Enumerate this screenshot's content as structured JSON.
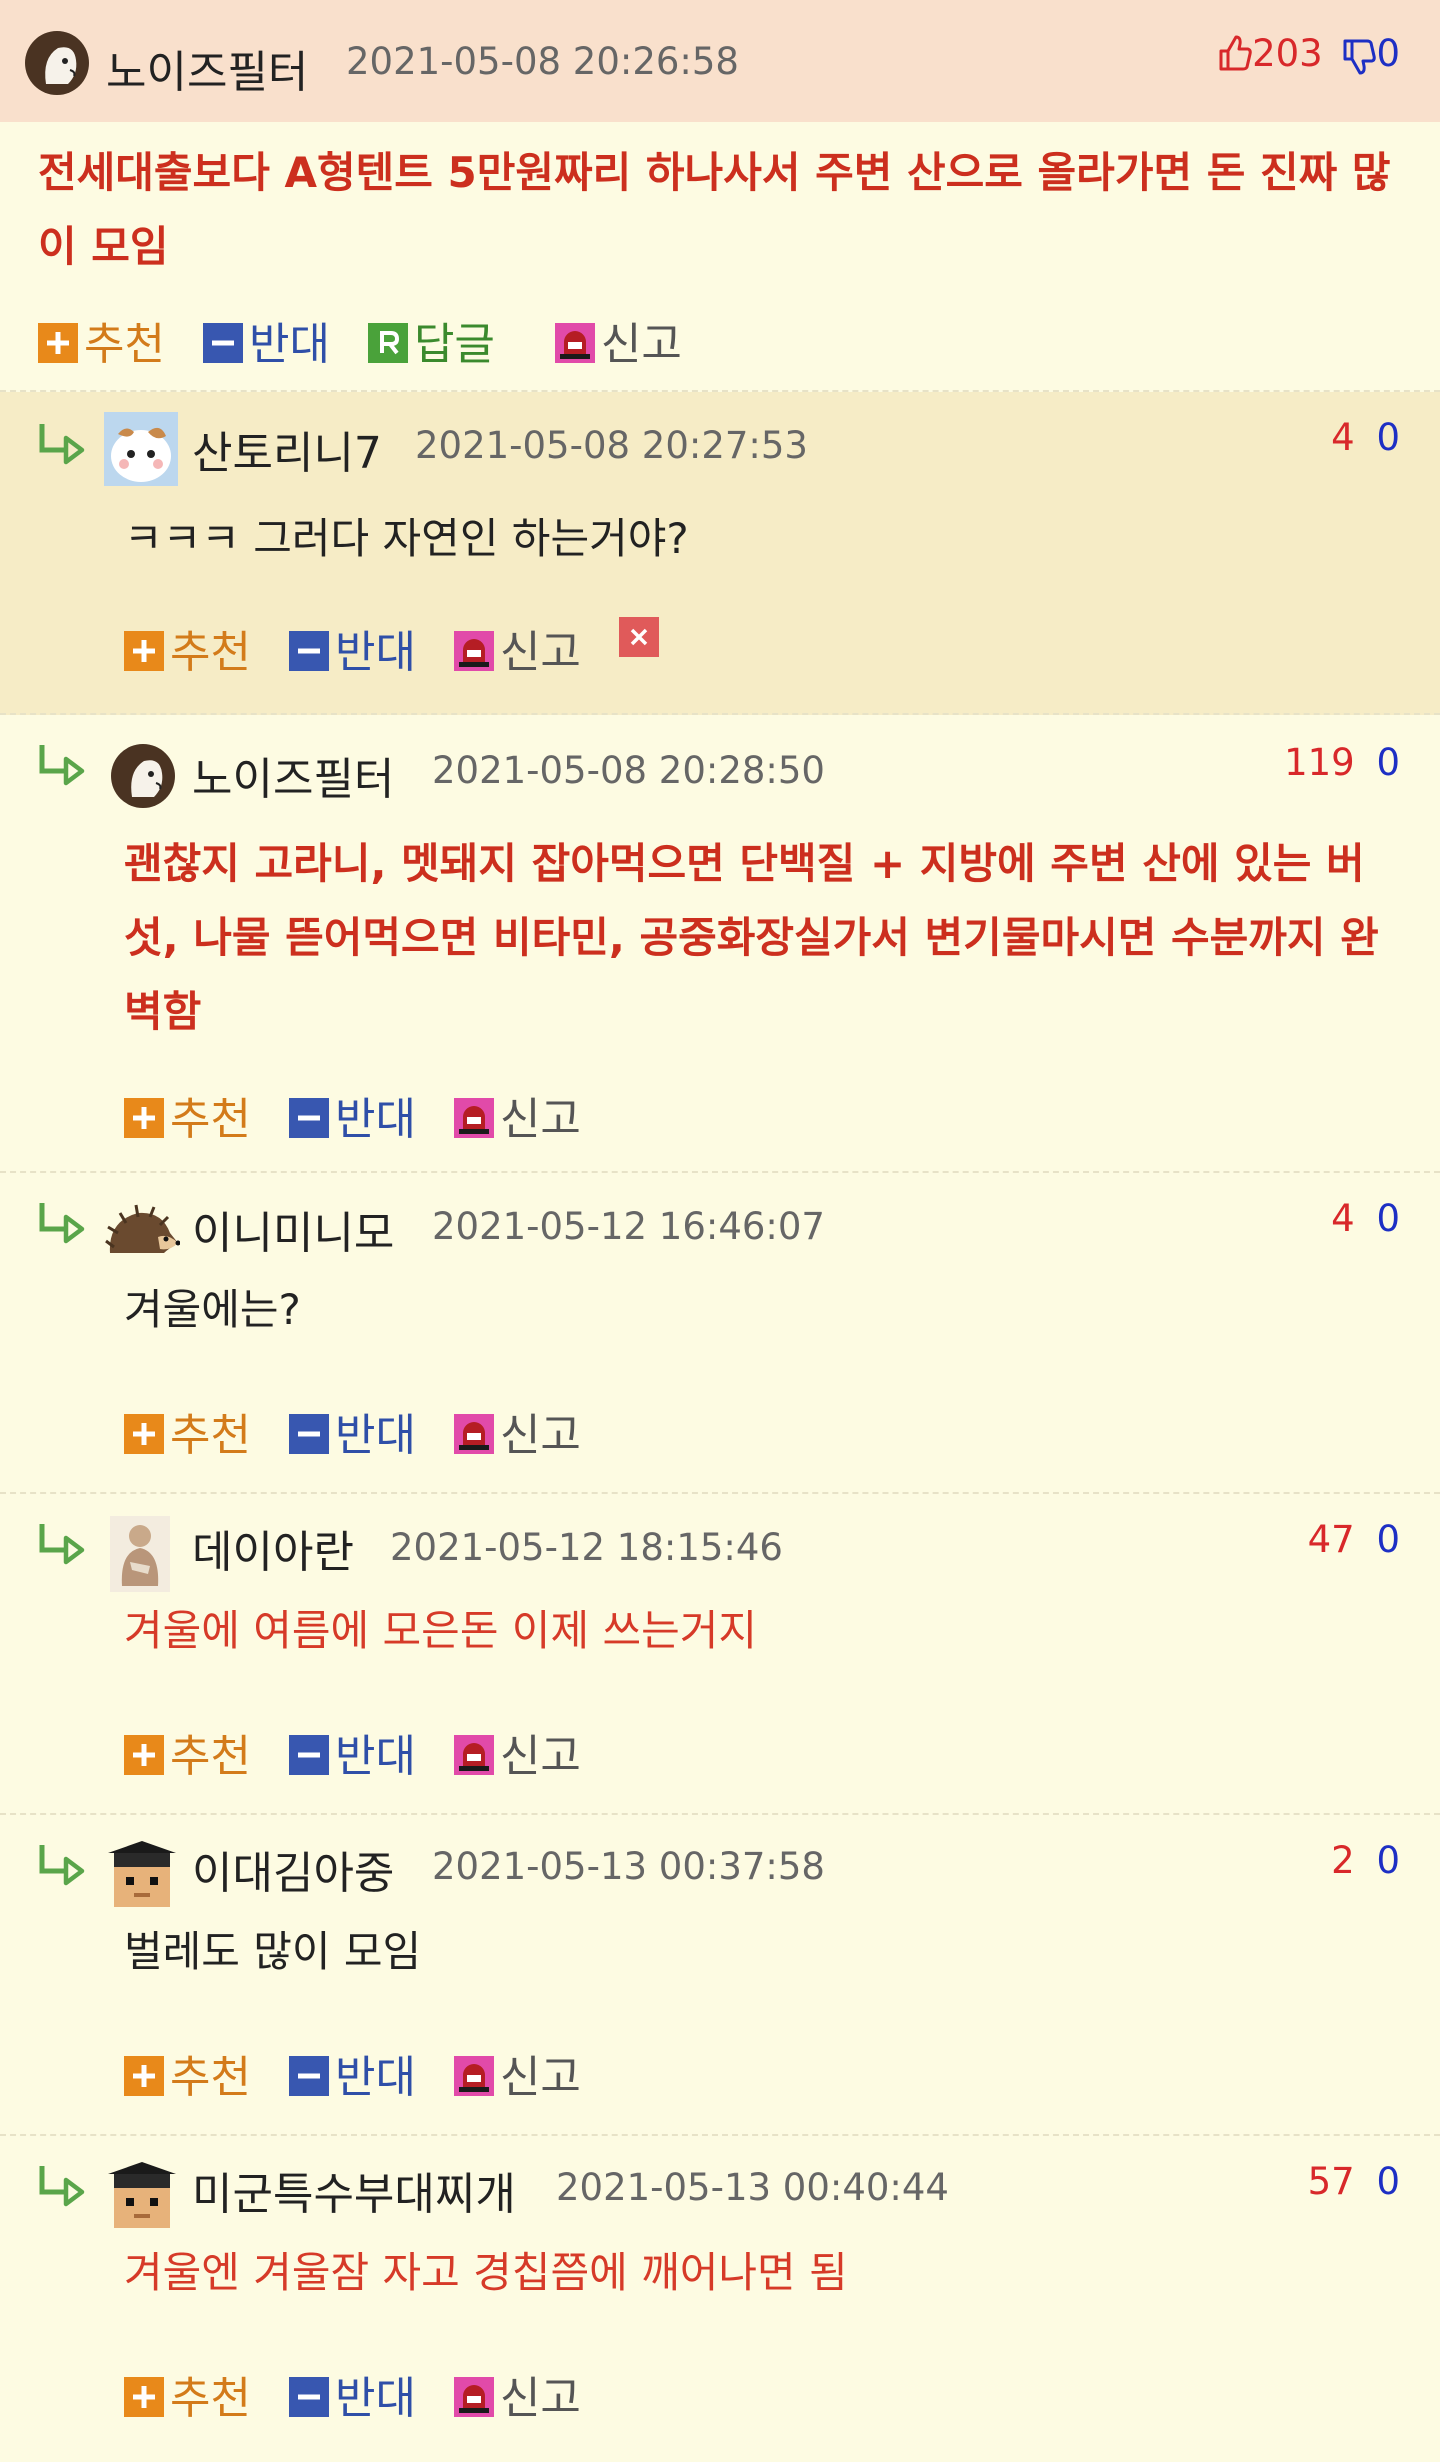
{
  "labels": {
    "recommend": "추천",
    "oppose": "반대",
    "reply": "답글",
    "report": "신고"
  },
  "comments": [
    {
      "nick": "노이즈필터",
      "date": "2021-05-08 20:26:58",
      "up": "203",
      "down": "0",
      "text": "전세대출보다 A형텐트 5만원짜리 하나사서 주변 산으로 올라가면 돈 진짜 많이 모임"
    },
    {
      "nick": "산토리니7",
      "date": "2021-05-08 20:27:53",
      "up": "4",
      "down": "0",
      "text": "ㅋㅋㅋ 그러다 자연인 하는거야?"
    },
    {
      "nick": "노이즈필터",
      "date": "2021-05-08 20:28:50",
      "up": "119",
      "down": "0",
      "text": "괜찮지 고라니, 멧돼지 잡아먹으면 단백질 + 지방에 주변 산에 있는 버섯, 나물 뜯어먹으면 비타민, 공중화장실가서 변기물마시면 수분까지 완벽함"
    },
    {
      "nick": "이니미니모",
      "date": "2021-05-12 16:46:07",
      "up": "4",
      "down": "0",
      "text": "겨울에는?"
    },
    {
      "nick": "데이아란",
      "date": "2021-05-12 18:15:46",
      "up": "47",
      "down": "0",
      "text": "겨울에 여름에 모은돈 이제 쓰는거지"
    },
    {
      "nick": "이대김아중",
      "date": "2021-05-13 00:37:58",
      "up": "2",
      "down": "0",
      "text": "벌레도 많이 모임"
    },
    {
      "nick": "미군특수부대찌개",
      "date": "2021-05-13 00:40:44",
      "up": "57",
      "down": "0",
      "text": "겨울엔 겨울잠 자고 경칩쯤에 깨어나면 됨"
    }
  ]
}
